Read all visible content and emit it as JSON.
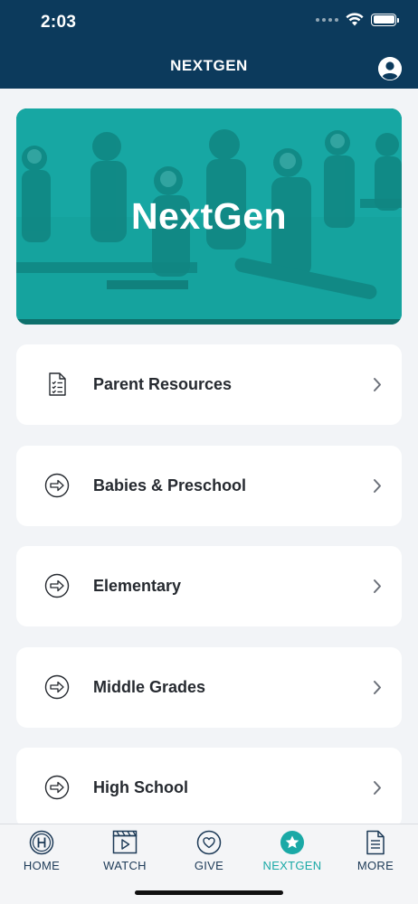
{
  "status_bar": {
    "time": "2:03"
  },
  "header": {
    "title": "NEXTGEN"
  },
  "hero": {
    "title": "NextGen"
  },
  "menu": [
    {
      "label": "Parent Resources",
      "icon": "checklist-document-icon"
    },
    {
      "label": "Babies & Preschool",
      "icon": "arrow-circle-icon"
    },
    {
      "label": "Elementary",
      "icon": "arrow-circle-icon"
    },
    {
      "label": "Middle Grades",
      "icon": "arrow-circle-icon"
    },
    {
      "label": "High School",
      "icon": "arrow-circle-icon"
    }
  ],
  "tabs": [
    {
      "label": "HOME",
      "icon": "home-icon",
      "active": false
    },
    {
      "label": "WATCH",
      "icon": "video-icon",
      "active": false
    },
    {
      "label": "GIVE",
      "icon": "heart-icon",
      "active": false
    },
    {
      "label": "NEXTGEN",
      "icon": "star-icon",
      "active": true
    },
    {
      "label": "MORE",
      "icon": "document-icon",
      "active": false
    }
  ],
  "colors": {
    "header_bg": "#0c3a5c",
    "accent_teal": "#1aa9a6",
    "page_bg": "#f2f4f7",
    "tab_text": "#1d3a57"
  }
}
